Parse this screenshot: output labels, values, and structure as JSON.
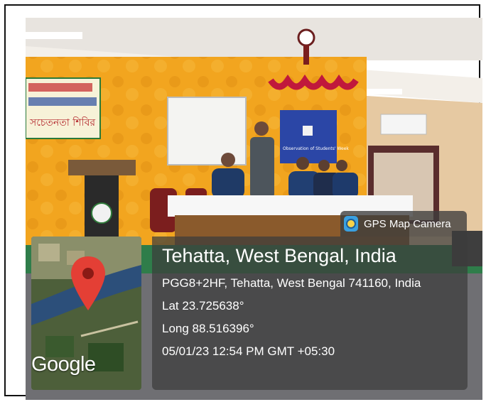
{
  "badge": {
    "label": "GPS Map Camera",
    "icon": "gps-camera-icon"
  },
  "location": {
    "title": "Tehatta, West Bengal, India",
    "address": "PGG8+2HF, Tehatta, West Bengal 741160, India",
    "lat": "Lat 23.725638°",
    "long": "Long 88.516396°",
    "datetime": "05/01/23 12:54 PM GMT +05:30"
  },
  "map": {
    "logo": "Google",
    "pin_icon": "map-pin-icon"
  },
  "banners": {
    "left_banner_text": "সচেতনতা শিবির",
    "right_banner_text": "Observation of Students' Week"
  },
  "colors": {
    "wall": "#f2a51f",
    "pin": "#e43f35",
    "overlay": "#3c3c3c"
  }
}
